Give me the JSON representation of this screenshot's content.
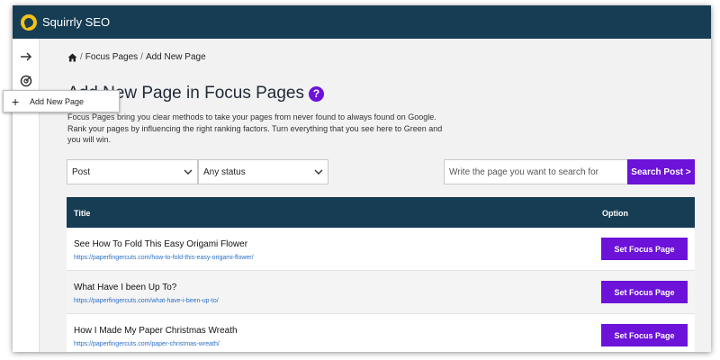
{
  "app": {
    "title": "Squirrly SEO"
  },
  "sidebar": {
    "items": [
      {
        "icon": "arrow-right-icon"
      },
      {
        "icon": "target-icon"
      }
    ]
  },
  "popup": {
    "label": "Add New Page"
  },
  "breadcrumb": {
    "items": [
      "Focus Pages",
      "Add New Page"
    ],
    "separator": "/"
  },
  "heading": {
    "visible_text": "Add New Page in Focus Pages",
    "help": "?"
  },
  "description": "Focus Pages bring you clear methods to take your pages from never found to always found on Google. Rank your pages by influencing the right ranking factors. Turn everything that you see here to Green and you will win.",
  "filters": {
    "post_type": "Post",
    "status": "Any status",
    "search_placeholder": "Write the page you want to search for",
    "search_button": "Search Post >"
  },
  "table": {
    "headers": {
      "title": "Title",
      "option": "Option"
    },
    "rows": [
      {
        "title": "See How To Fold This Easy Origami Flower",
        "url": "https://paperfingercuts.com/how-to-fold-this-easy-origami-flower/",
        "button": "Set Focus Page"
      },
      {
        "title": "What Have I been Up To?",
        "url": "https://paperfingercuts.com/what-have-i-been-up-to/",
        "button": "Set Focus Page"
      },
      {
        "title": "How I Made My Paper Christmas Wreath",
        "url": "https://paperfingercuts.com/paper-christmas-wreath/",
        "button": "Set Focus Page"
      }
    ]
  },
  "colors": {
    "header": "#173d55",
    "accent": "#6c12d9",
    "logo": "#f5c116",
    "link": "#2a6fc9"
  }
}
